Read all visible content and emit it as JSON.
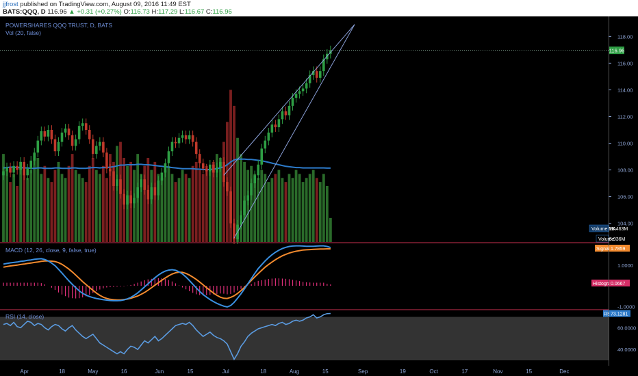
{
  "header": {
    "author": "jjfrost",
    "published": " published on TradingView.com, August 09, 2016 11:49 EST",
    "symbol": "BATS:QQQ, D",
    "last": "116.96",
    "change": "▲ +0.31 (+0.27%)",
    "o_label": "O:",
    "o_value": "116.73",
    "h_label": "H:",
    "h_value": "117.29",
    "l_label": "L:",
    "l_value": "116.67",
    "c_label": "C:",
    "c_value": "116.96"
  },
  "colors": {
    "background": "#000000",
    "up": "#2e9e44",
    "down": "#c0392b",
    "line": "#4a90d9",
    "macd": "#3a8fe0",
    "signal": "#f28a2e",
    "histogram": "#e0307a",
    "rsi": "#5b9be0",
    "trendline": "#8aa0d8",
    "vol_ma": "#2c7ac9"
  },
  "chart_data": [
    {
      "type": "candlestick",
      "pane": "price",
      "title": "POWERSHARES QQQ TRUST, D, BATS",
      "indicator_label": "Vol (20, false)",
      "y_ticks": [
        "118.00",
        "116.00",
        "114.00",
        "112.00",
        "110.00",
        "108.00",
        "106.00",
        "104.00"
      ],
      "ylim": [
        102.6,
        119.4
      ],
      "last_price_label": "116.96",
      "last_price": 116.96,
      "x_tick_labels": [
        "Apr",
        "18",
        "May",
        "16",
        "Jun",
        "15",
        "Jul",
        "18",
        "Aug",
        "15",
        "Sep",
        "19",
        "Oct",
        "17",
        "Nov",
        "15",
        "Dec"
      ],
      "x_tick_dates": [
        "2016-04-01",
        "2016-04-18",
        "2016-05-02",
        "2016-05-16",
        "2016-06-01",
        "2016-06-15",
        "2016-07-01",
        "2016-07-18",
        "2016-08-01",
        "2016-08-15",
        "2016-09-01",
        "2016-09-19",
        "2016-10-03",
        "2016-10-17",
        "2016-11-01",
        "2016-11-15",
        "2016-12-01"
      ],
      "xlim": [
        "2016-03-21",
        "2016-12-21"
      ],
      "closes": [
        107.9,
        108.2,
        107.8,
        108.3,
        108.0,
        108.6,
        107.6,
        108.1,
        108.7,
        109.3,
        110.2,
        110.9,
        110.5,
        111.0,
        110.3,
        109.4,
        110.1,
        110.8,
        111.1,
        110.6,
        109.8,
        110.3,
        111.3,
        111.5,
        111.0,
        110.3,
        109.2,
        109.8,
        110.1,
        109.3,
        108.1,
        107.9,
        106.8,
        107.3,
        106.2,
        105.4,
        106.1,
        105.5,
        105.9,
        106.7,
        107.3,
        106.5,
        105.8,
        106.7,
        106.1,
        107.2,
        107.8,
        108.5,
        109.4,
        110.1,
        110.0,
        110.4,
        110.6,
        110.3,
        110.6,
        110.1,
        109.2,
        108.5,
        108.1,
        107.9,
        108.4,
        107.8,
        108.2,
        108.6,
        107.1,
        106.4,
        104.0,
        102.8,
        103.9,
        104.6,
        105.7,
        106.1,
        107.0,
        107.6,
        108.4,
        109.6,
        110.2,
        110.8,
        111.4,
        111.2,
        111.8,
        112.4,
        112.1,
        112.8,
        113.4,
        113.7,
        113.9,
        114.1,
        114.5,
        115.1,
        115.4,
        114.9,
        115.4,
        116.3,
        116.7,
        116.96
      ],
      "volume_ma_label": "Volume MA",
      "volume_ma_value": "18.463M",
      "volume_label": "Volume",
      "volume_value": "5.936M",
      "volume_ylim": [
        0,
        56
      ],
      "volumes": [
        22,
        18,
        15,
        17,
        14,
        20,
        19,
        16,
        18,
        22,
        21,
        17,
        19,
        16,
        15,
        18,
        20,
        17,
        16,
        19,
        22,
        18,
        17,
        16,
        15,
        19,
        21,
        18,
        17,
        19,
        16,
        22,
        20,
        24,
        25,
        21,
        19,
        20,
        18,
        22,
        17,
        19,
        21,
        18,
        20,
        17,
        16,
        18,
        19,
        17,
        15,
        16,
        18,
        17,
        16,
        19,
        20,
        18,
        17,
        19,
        18,
        20,
        22,
        21,
        25,
        30,
        38,
        34,
        26,
        22,
        20,
        18,
        19,
        17,
        16,
        18,
        17,
        15,
        16,
        17,
        18,
        16,
        15,
        17,
        16,
        18,
        17,
        15,
        16,
        17,
        18,
        16,
        15,
        17,
        14,
        6
      ],
      "volume_ma": [
        18.5,
        18.6,
        18.7,
        18.7,
        18.6,
        18.6,
        18.5,
        18.5,
        18.4,
        18.4,
        18.5,
        18.5,
        18.4,
        18.4,
        18.4,
        18.5,
        18.5,
        18.4,
        18.4,
        18.4,
        18.5,
        18.5,
        18.4,
        18.4,
        18.4,
        18.5,
        18.6,
        18.6,
        18.5,
        18.6,
        18.6,
        18.7,
        18.8,
        19.0,
        19.2,
        19.2,
        19.3,
        19.3,
        19.3,
        19.4,
        19.4,
        19.3,
        19.3,
        19.2,
        19.1,
        19.0,
        18.9,
        18.8,
        18.7,
        18.6,
        18.5,
        18.4,
        18.3,
        18.3,
        18.3,
        18.3,
        18.2,
        18.2,
        18.1,
        18.1,
        18.1,
        18.2,
        18.3,
        18.5,
        18.8,
        19.3,
        20.0,
        20.5,
        20.7,
        20.7,
        20.7,
        20.6,
        20.6,
        20.5,
        20.4,
        20.3,
        20.1,
        19.9,
        19.7,
        19.5,
        19.3,
        19.1,
        18.9,
        18.8,
        18.7,
        18.6,
        18.6,
        18.5,
        18.5,
        18.5,
        18.5,
        18.5,
        18.5,
        18.5,
        18.46,
        18.46
      ],
      "trendlines": [
        {
          "from": [
            67,
            102.9
          ],
          "to": [
            102,
            118.9
          ]
        },
        {
          "from": [
            64,
            107.6
          ],
          "to": [
            102,
            118.9
          ]
        }
      ]
    },
    {
      "type": "line",
      "pane": "macd",
      "indicator_label": "MACD (12, 26, close, 9, false, true)",
      "y_ticks": [
        "1.0000",
        "-1.0000"
      ],
      "ylim": [
        -1.12,
        2.05
      ],
      "series": [
        {
          "name": "Signal",
          "value_label": "1.7859",
          "values": [
            0.9,
            0.93,
            0.96,
            0.98,
            1.0,
            1.03,
            1.05,
            1.08,
            1.1,
            1.13,
            1.15,
            1.18,
            1.2,
            1.2,
            1.19,
            1.17,
            1.12,
            1.04,
            0.93,
            0.81,
            0.67,
            0.52,
            0.36,
            0.2,
            0.06,
            -0.08,
            -0.22,
            -0.35,
            -0.46,
            -0.55,
            -0.61,
            -0.65,
            -0.67,
            -0.68,
            -0.68,
            -0.66,
            -0.64,
            -0.6,
            -0.55,
            -0.49,
            -0.41,
            -0.32,
            -0.21,
            -0.09,
            0.03,
            0.15,
            0.27,
            0.38,
            0.48,
            0.57,
            0.63,
            0.66,
            0.65,
            0.6,
            0.52,
            0.42,
            0.31,
            0.18,
            0.05,
            -0.09,
            -0.22,
            -0.35,
            -0.46,
            -0.55,
            -0.6,
            -0.61,
            -0.56,
            -0.48,
            -0.37,
            -0.23,
            -0.08,
            0.09,
            0.26,
            0.43,
            0.59,
            0.75,
            0.9,
            1.03,
            1.15,
            1.26,
            1.36,
            1.45,
            1.52,
            1.58,
            1.63,
            1.67,
            1.7,
            1.73,
            1.74,
            1.75,
            1.76,
            1.77,
            1.78,
            1.78,
            1.785,
            1.7859
          ]
        },
        {
          "name": "MACD",
          "values": [
            1.05,
            1.08,
            1.11,
            1.13,
            1.15,
            1.18,
            1.2,
            1.23,
            1.25,
            1.28,
            1.3,
            1.31,
            1.27,
            1.2,
            1.1,
            0.97,
            0.8,
            0.62,
            0.43,
            0.24,
            0.07,
            -0.09,
            -0.24,
            -0.36,
            -0.45,
            -0.52,
            -0.57,
            -0.61,
            -0.64,
            -0.67,
            -0.69,
            -0.71,
            -0.72,
            -0.72,
            -0.71,
            -0.68,
            -0.63,
            -0.56,
            -0.46,
            -0.34,
            -0.2,
            -0.05,
            0.1,
            0.25,
            0.39,
            0.52,
            0.63,
            0.71,
            0.76,
            0.78,
            0.75,
            0.68,
            0.57,
            0.43,
            0.26,
            0.08,
            -0.1,
            -0.27,
            -0.42,
            -0.55,
            -0.66,
            -0.76,
            -0.85,
            -0.92,
            -0.98,
            -1.02,
            -0.95,
            -0.8,
            -0.6,
            -0.38,
            -0.15,
            0.1,
            0.35,
            0.6,
            0.83,
            1.02,
            1.2,
            1.36,
            1.5,
            1.62,
            1.72,
            1.8,
            1.86,
            1.9,
            1.92,
            1.93,
            1.93,
            1.92,
            1.91,
            1.91,
            1.91,
            1.92,
            1.93,
            1.93,
            1.9,
            1.85
          ]
        }
      ],
      "histogram_label": "Histogram",
      "histogram_value_label": "0.0667",
      "histogram": [
        0.15,
        0.15,
        0.15,
        0.15,
        0.15,
        0.15,
        0.15,
        0.15,
        0.15,
        0.15,
        0.15,
        0.13,
        0.07,
        0.0,
        -0.09,
        -0.2,
        -0.32,
        -0.42,
        -0.5,
        -0.57,
        -0.6,
        -0.61,
        -0.6,
        -0.56,
        -0.51,
        -0.44,
        -0.35,
        -0.26,
        -0.18,
        -0.12,
        -0.08,
        -0.06,
        -0.05,
        -0.04,
        -0.03,
        -0.02,
        0.01,
        0.04,
        0.09,
        0.15,
        0.21,
        0.27,
        0.31,
        0.34,
        0.36,
        0.37,
        0.36,
        0.33,
        0.28,
        0.21,
        0.12,
        0.02,
        -0.08,
        -0.17,
        -0.26,
        -0.34,
        -0.41,
        -0.45,
        -0.47,
        -0.46,
        -0.44,
        -0.41,
        -0.39,
        -0.37,
        -0.38,
        -0.41,
        -0.39,
        -0.32,
        -0.23,
        -0.15,
        -0.07,
        0.01,
        0.09,
        0.17,
        0.24,
        0.27,
        0.3,
        0.33,
        0.35,
        0.36,
        0.36,
        0.35,
        0.34,
        0.32,
        0.29,
        0.26,
        0.23,
        0.19,
        0.17,
        0.16,
        0.15,
        0.15,
        0.15,
        0.15,
        0.1,
        0.0667
      ]
    },
    {
      "type": "line",
      "pane": "rsi",
      "indicator_label": "RSI (14, close)",
      "value_label": "RSI",
      "value": "73.1281",
      "y_ticks": [
        "60.0000",
        "40.0000"
      ],
      "ylim": [
        25,
        76
      ],
      "band": [
        30,
        70
      ],
      "values": [
        63,
        64,
        62,
        65,
        61,
        60,
        63,
        66,
        65,
        62,
        64,
        63,
        60,
        58,
        61,
        63,
        62,
        59,
        57,
        60,
        62,
        58,
        55,
        52,
        50,
        52,
        54,
        50,
        46,
        44,
        42,
        40,
        38,
        36,
        38,
        36,
        40,
        43,
        42,
        40,
        44,
        48,
        46,
        49,
        52,
        48,
        50,
        53,
        56,
        59,
        62,
        63,
        64,
        63,
        65,
        62,
        58,
        55,
        52,
        54,
        56,
        53,
        51,
        50,
        48,
        45,
        38,
        31,
        36,
        43,
        47,
        52,
        55,
        57,
        59,
        60,
        61,
        62,
        63,
        62,
        64,
        65,
        63,
        64,
        66,
        67,
        66,
        67,
        69,
        70,
        72,
        69,
        70,
        72,
        73,
        73.1281
      ]
    }
  ]
}
